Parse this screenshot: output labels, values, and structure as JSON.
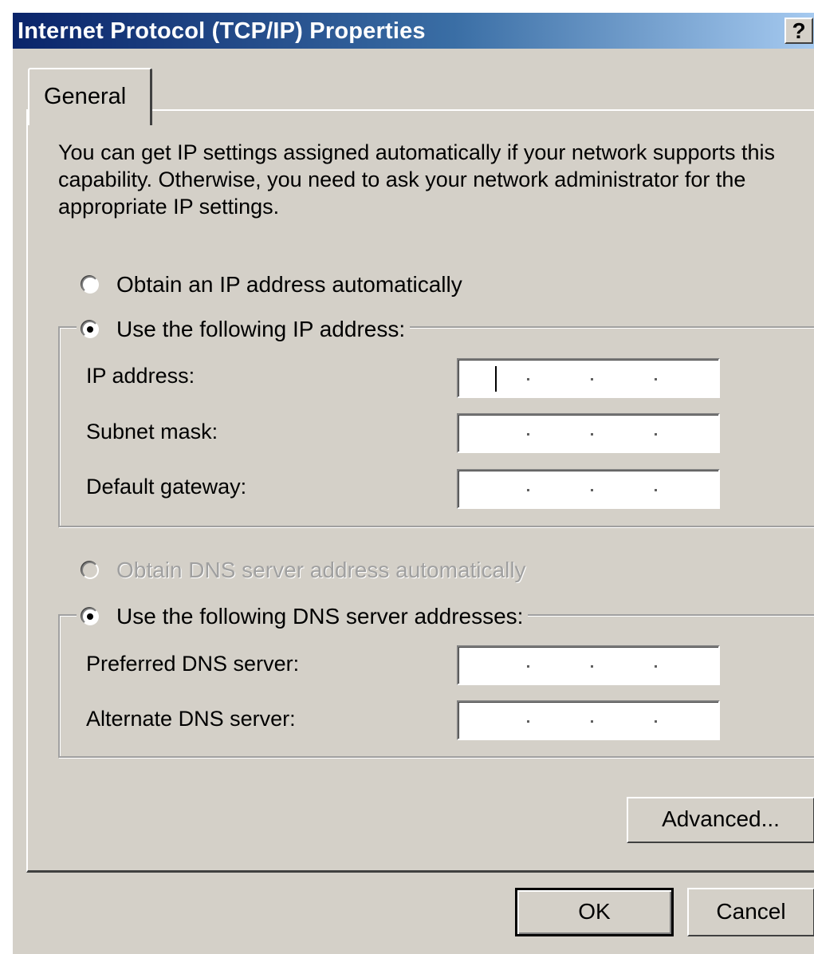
{
  "window": {
    "title": "Internet Protocol (TCP/IP) Properties",
    "help_button": "?"
  },
  "tabs": [
    {
      "label": "General",
      "selected": true
    }
  ],
  "general": {
    "description": "You can get IP settings assigned automatically if your network supports this capability. Otherwise, you need to ask your network administrator for the appropriate IP settings.",
    "ip_auto_radio": {
      "label": "Obtain an IP address automatically",
      "checked": false,
      "enabled": true
    },
    "ip_manual_radio": {
      "label": "Use the following IP address:",
      "checked": true,
      "enabled": true
    },
    "ip_fields": {
      "ip_address": {
        "label": "IP address:",
        "value": ""
      },
      "subnet_mask": {
        "label": "Subnet mask:",
        "value": ""
      },
      "default_gateway": {
        "label": "Default gateway:",
        "value": ""
      }
    },
    "dns_auto_radio": {
      "label": "Obtain DNS server address automatically",
      "checked": false,
      "enabled": false
    },
    "dns_manual_radio": {
      "label": "Use the following DNS server addresses:",
      "checked": true,
      "enabled": true
    },
    "dns_fields": {
      "preferred": {
        "label": "Preferred DNS server:",
        "value": ""
      },
      "alternate": {
        "label": "Alternate DNS server:",
        "value": ""
      }
    },
    "advanced_button": "Advanced..."
  },
  "footer": {
    "ok_button": "OK",
    "cancel_button": "Cancel"
  },
  "colors": {
    "dialog_face": "#d4d0c8",
    "title_gradient_start": "#0a246a",
    "title_gradient_end": "#a6caf0",
    "disabled_text": "#a0a0a0"
  }
}
